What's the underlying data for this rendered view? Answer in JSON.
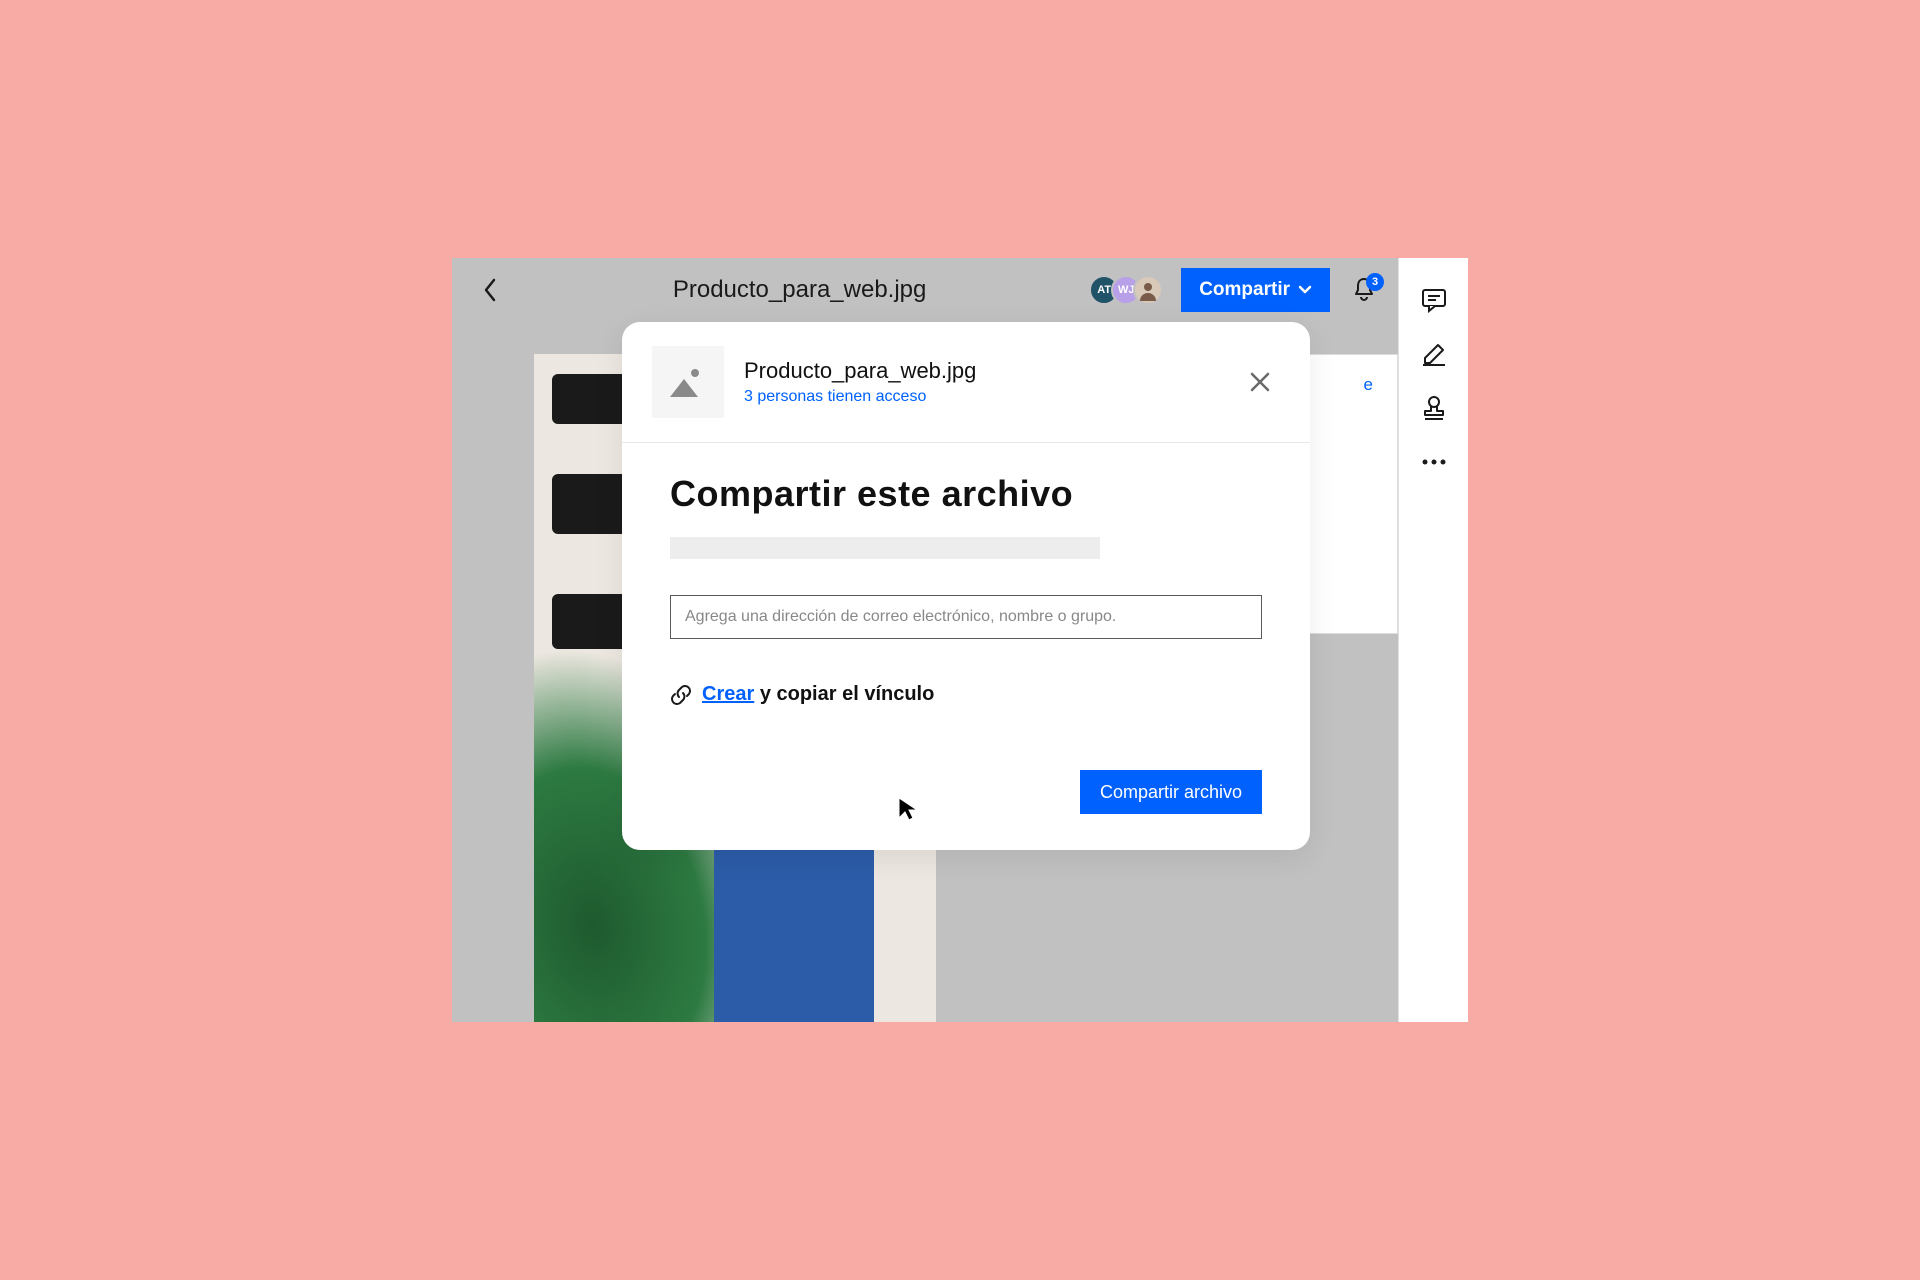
{
  "topbar": {
    "file_title": "Producto_para_web.jpg",
    "share_button": "Compartir",
    "avatars": [
      "AT",
      "WJ",
      ""
    ],
    "notification_count": "3"
  },
  "side_panel": {
    "fragment": "e"
  },
  "modal": {
    "file_name": "Producto_para_web.jpg",
    "access_text": "3 personas tienen acceso",
    "heading": "Compartir este archivo",
    "email_placeholder": "Agrega una dirección de correo electrónico, nombre o grupo.",
    "link_create": "Crear",
    "link_copy_suffix": " y copiar el vínculo",
    "share_file_button": "Compartir archivo"
  }
}
